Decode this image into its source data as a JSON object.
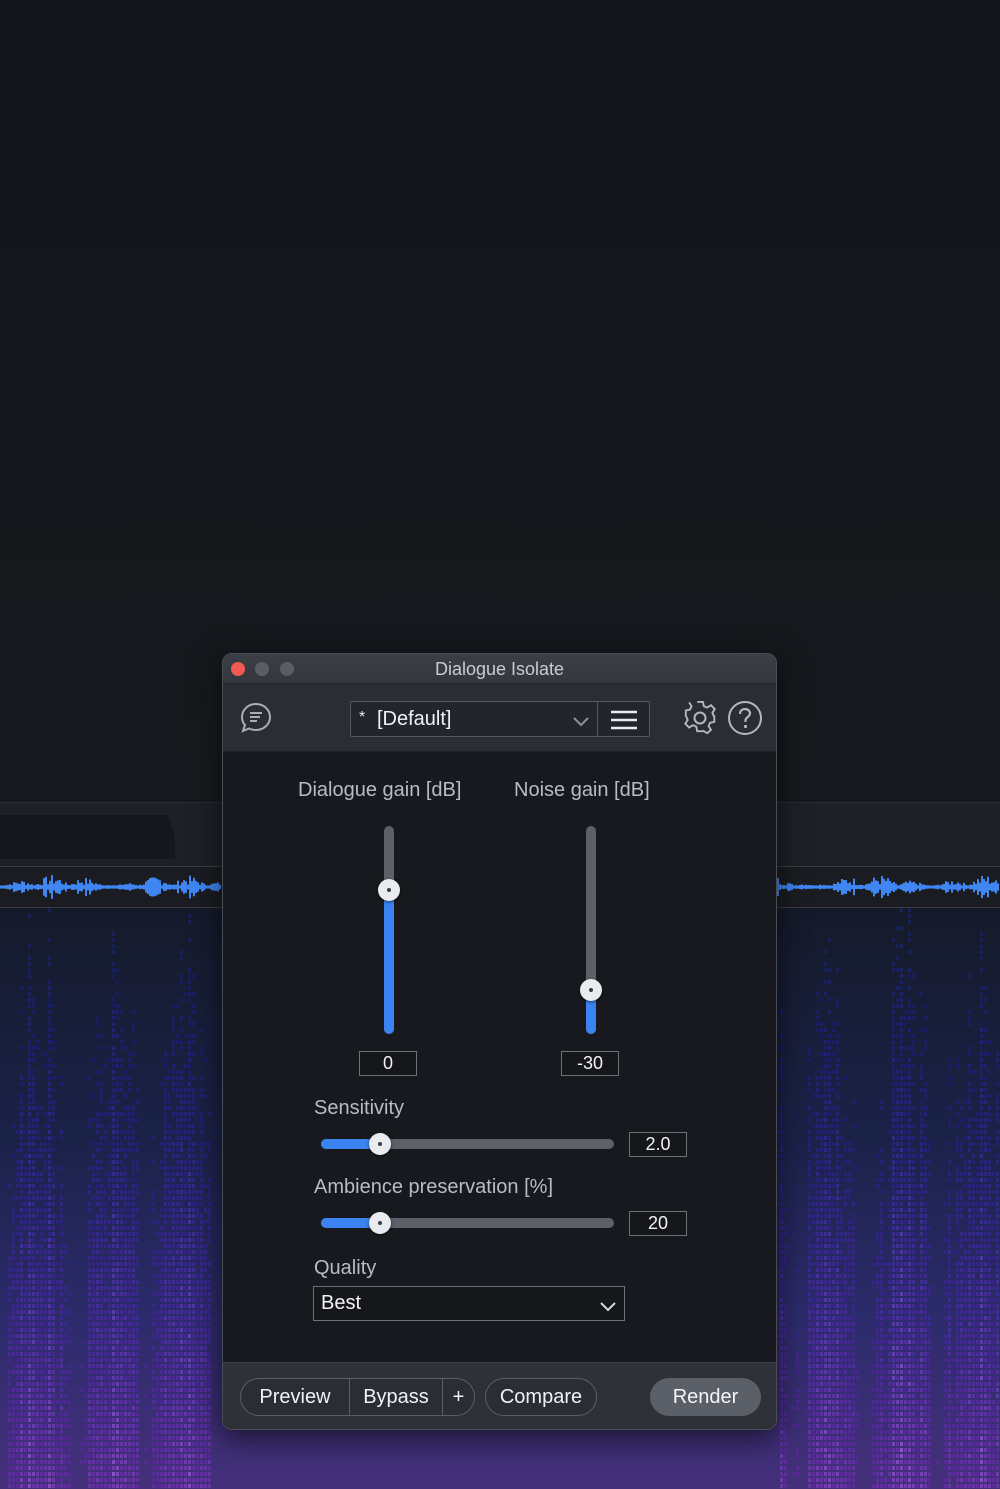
{
  "window": {
    "title": "Dialogue Isolate"
  },
  "header": {
    "preset_marker": "*",
    "preset_name": "[Default]"
  },
  "sliders": {
    "dialogue_gain": {
      "label": "Dialogue gain [dB]",
      "value": "0",
      "level": 0.69
    },
    "noise_gain": {
      "label": "Noise gain [dB]",
      "value": "-30",
      "level": 0.21
    },
    "sensitivity": {
      "label": "Sensitivity",
      "value": "2.0",
      "level": 0.2
    },
    "ambience_preservation": {
      "label": "Ambience preservation [%]",
      "value": "20",
      "level": 0.2
    }
  },
  "quality": {
    "label": "Quality",
    "value": "Best"
  },
  "footer": {
    "preview": "Preview",
    "bypass": "Bypass",
    "plus": "+",
    "compare": "Compare",
    "render": "Render"
  },
  "colors": {
    "accent": "#3b83f0",
    "close": "#f05a52",
    "panel": "#17191e"
  },
  "icons": [
    "chat-icon",
    "chevron-down-icon",
    "hamburger-menu-icon",
    "gear-icon",
    "help-icon"
  ]
}
